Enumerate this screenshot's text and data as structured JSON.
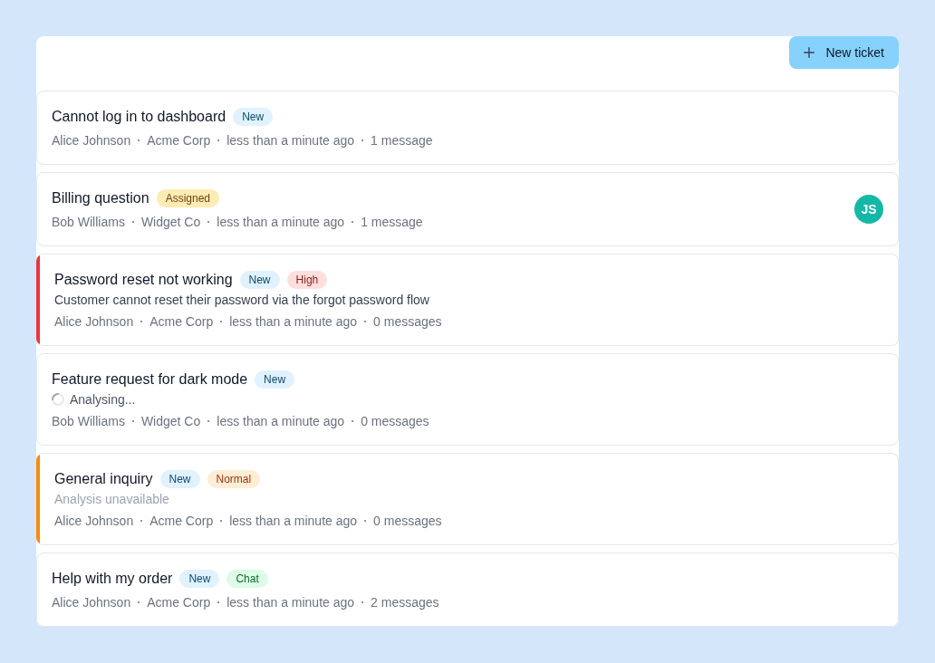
{
  "toolbar": {
    "new_button": {
      "label": "New ticket"
    }
  },
  "tickets": [
    {
      "title": "Cannot log in to dashboard",
      "badges": [
        {
          "label": "New",
          "color": "#e0f2fe"
        }
      ],
      "meta": {
        "customer": "Alice Johnson",
        "company": "Acme Corp",
        "time": "less than a minute ago",
        "messages": "1 message"
      }
    },
    {
      "title": "Billing question",
      "badges": [
        {
          "label": "Assigned",
          "color": "#fdecb3"
        }
      ],
      "meta": {
        "customer": "Bob Williams",
        "company": "Widget Co",
        "time": "less than a minute ago",
        "messages": "1 message"
      },
      "assignee": {
        "initials": "JS"
      }
    },
    {
      "title": "Password reset not working",
      "color": "#ef3340",
      "badges": [
        {
          "label": "New",
          "color": "#e0f2fe"
        },
        {
          "label": "High",
          "color": "#fde0dd"
        }
      ],
      "summary": {
        "kind": "description",
        "text": "Customer cannot reset their password via the forgot password flow"
      },
      "meta": {
        "customer": "Alice Johnson",
        "company": "Acme Corp",
        "time": "less than a minute ago",
        "messages": "0 messages"
      }
    },
    {
      "title": "Feature request for dark mode",
      "badges": [
        {
          "label": "New",
          "color": "#e0f2fe"
        }
      ],
      "summary": {
        "kind": "analysing",
        "text": "Analysing..."
      },
      "meta": {
        "customer": "Bob Williams",
        "company": "Widget Co",
        "time": "less than a minute ago",
        "messages": "0 messages"
      }
    },
    {
      "title": "General inquiry",
      "color": "#f98a0c",
      "badges": [
        {
          "label": "New",
          "color": "#e0f2fe"
        },
        {
          "label": "Normal",
          "color": "#ffedd5"
        }
      ],
      "summary": {
        "kind": "unavailable",
        "text": "Analysis unavailable"
      },
      "meta": {
        "customer": "Alice Johnson",
        "company": "Acme Corp",
        "time": "less than a minute ago",
        "messages": "0 messages"
      }
    },
    {
      "title": "Help with my order",
      "badges": [
        {
          "label": "New",
          "color": "#e0f2fe"
        },
        {
          "label": "Chat",
          "color": "#dcfce7"
        }
      ],
      "meta": {
        "customer": "Alice Johnson",
        "company": "Acme Corp",
        "time": "less than a minute ago",
        "messages": "2 messages"
      }
    }
  ]
}
